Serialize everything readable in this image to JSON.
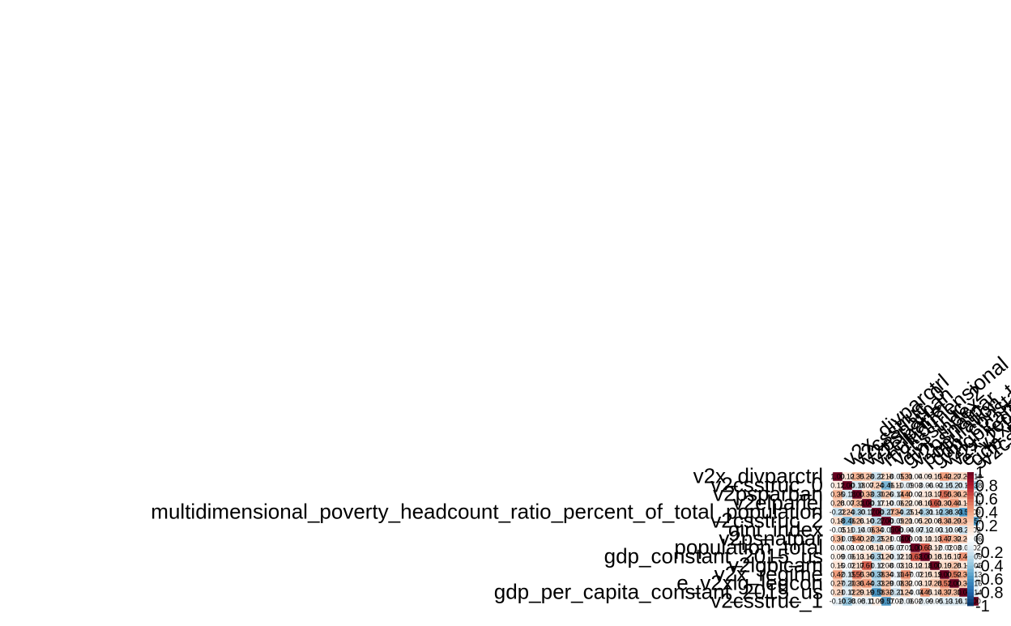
{
  "chart_data": {
    "type": "heatmap",
    "subtype": "correlation-matrix",
    "title": "",
    "xlabel": "",
    "ylabel": "",
    "cell_labels_shown": true,
    "legend": "right",
    "colorbar": {
      "ticks": [
        "1",
        "0.8",
        "0.6",
        "0.4",
        "0.2",
        "0",
        "-0.2",
        "-0.4",
        "-0.6",
        "-0.8",
        "-1"
      ],
      "range": [
        -1,
        1
      ],
      "colors": [
        "#67001F",
        "#B2182B",
        "#D6604D",
        "#F4A582",
        "#FDDBC7",
        "#FFFFFF",
        "#D1E5F0",
        "#92C5DE",
        "#4393C3",
        "#2166AC",
        "#053061"
      ]
    },
    "variables": [
      "v2x_divparctrl",
      "v2csstruc_0",
      "v2psparban",
      "v2elparlel",
      "multidimensional_poverty_headcount_ratio_percent_of_total_population",
      "v2csstruc_2",
      "gini_index",
      "v2psnatpar",
      "population_total",
      "gdp_constant_2015_us",
      "v2lgbicam",
      "v2x_regime",
      "e_v2xlg_legcon",
      "gdp_per_capita_constant_2015_us",
      "v2csstruc_1"
    ],
    "values": [
      [
        1.0,
        0.12,
        0.35,
        0.28,
        -0.22,
        0.18,
        -0.05,
        0.31,
        0.04,
        0.09,
        0.15,
        0.42,
        0.27,
        0.21,
        -0.1
      ],
      [
        0.12,
        1.0,
        -0.18,
        0.07,
        0.24,
        -0.46,
        0.11,
        -0.09,
        0.03,
        -0.06,
        -0.02,
        -0.15,
        -0.2,
        -0.12,
        -0.38
      ],
      [
        0.35,
        -0.18,
        1.0,
        0.33,
        -0.3,
        0.26,
        -0.14,
        0.4,
        0.02,
        0.13,
        0.17,
        0.55,
        0.36,
        0.29,
        -0.08
      ],
      [
        0.28,
        0.07,
        0.33,
        1.0,
        -0.17,
        0.1,
        -0.06,
        0.22,
        0.08,
        0.16,
        0.61,
        0.3,
        0.44,
        0.19,
        -0.11
      ],
      [
        -0.22,
        0.24,
        -0.3,
        -0.17,
        1.0,
        -0.27,
        0.34,
        -0.25,
        0.14,
        -0.31,
        -0.12,
        -0.38,
        -0.33,
        -0.58,
        0.09
      ],
      [
        0.18,
        -0.46,
        0.26,
        0.1,
        -0.27,
        1.0,
        -0.09,
        0.21,
        0.05,
        0.2,
        0.08,
        0.34,
        0.29,
        0.32,
        -0.57
      ],
      [
        -0.05,
        0.11,
        -0.14,
        -0.06,
        0.34,
        -0.09,
        1.0,
        -0.04,
        -0.07,
        -0.12,
        -0.03,
        -0.1,
        -0.08,
        -0.21,
        0.02
      ],
      [
        0.31,
        -0.09,
        0.4,
        0.22,
        -0.25,
        0.21,
        -0.04,
        1.0,
        0.01,
        0.11,
        0.13,
        0.47,
        0.32,
        0.24,
        -0.06
      ],
      [
        0.04,
        0.03,
        0.02,
        0.08,
        0.14,
        0.05,
        -0.07,
        0.01,
        1.0,
        0.63,
        0.12,
        -0.02,
        0.03,
        -0.04,
        0.02
      ],
      [
        0.09,
        -0.06,
        0.13,
        0.16,
        -0.31,
        0.2,
        -0.12,
        0.11,
        0.63,
        1.0,
        0.18,
        0.15,
        0.17,
        0.45,
        -0.09
      ],
      [
        0.15,
        -0.02,
        0.17,
        0.61,
        -0.12,
        0.08,
        -0.03,
        0.13,
        0.12,
        0.18,
        1.0,
        0.19,
        0.28,
        0.14,
        -0.05
      ],
      [
        0.42,
        -0.15,
        0.55,
        0.3,
        -0.38,
        0.34,
        -0.1,
        0.47,
        -0.02,
        0.15,
        0.19,
        1.0,
        0.52,
        0.37,
        -0.13
      ],
      [
        0.27,
        -0.2,
        0.36,
        0.44,
        -0.33,
        0.29,
        -0.08,
        0.32,
        0.03,
        0.17,
        0.28,
        0.52,
        1.0,
        0.3,
        -0.16
      ],
      [
        0.21,
        -0.12,
        0.29,
        0.19,
        -0.58,
        0.32,
        -0.21,
        0.24,
        -0.04,
        0.45,
        0.14,
        0.37,
        0.3,
        1.0,
        -0.14
      ],
      [
        -0.1,
        -0.38,
        -0.08,
        -0.11,
        0.09,
        -0.57,
        0.02,
        -0.06,
        0.02,
        -0.09,
        -0.05,
        -0.13,
        -0.16,
        -0.14,
        1.0
      ]
    ]
  }
}
